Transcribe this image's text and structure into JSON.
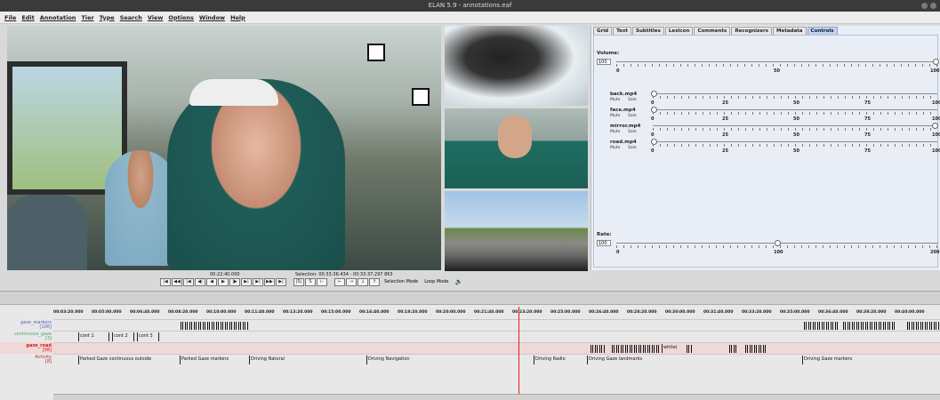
{
  "window": {
    "title": "ELAN 5.9 - annotations.eaf"
  },
  "menu": [
    "File",
    "Edit",
    "Annotation",
    "Tier",
    "Type",
    "Search",
    "View",
    "Options",
    "Window",
    "Help"
  ],
  "tabs": [
    "Grid",
    "Text",
    "Subtitles",
    "Lexicon",
    "Comments",
    "Recognizers",
    "Metadata",
    "Controls"
  ],
  "controls": {
    "volume_label": "Volume:",
    "volume_value": "100",
    "volume_ticks": [
      "0",
      "50",
      "100"
    ],
    "media": [
      {
        "name": "back.mp4",
        "mute": "Mute",
        "solo": "Solo",
        "ticks": [
          "0",
          "25",
          "50",
          "75",
          "100"
        ]
      },
      {
        "name": "face.mp4",
        "mute": "Mute",
        "solo": "Solo",
        "ticks": [
          "0",
          "25",
          "50",
          "75",
          "100"
        ]
      },
      {
        "name": "mirror.mp4",
        "mute": "Mute",
        "solo": "Solo",
        "ticks": [
          "0",
          "25",
          "50",
          "75",
          "100"
        ]
      },
      {
        "name": "road.mp4",
        "mute": "Mute",
        "solo": "Solo",
        "ticks": [
          "0",
          "25",
          "50",
          "75",
          "100"
        ]
      }
    ],
    "rate_label": "Rate:",
    "rate_value": "100",
    "rate_ticks": [
      "0",
      "100",
      "200"
    ]
  },
  "player": {
    "time": "00:22:40.000",
    "selection": "Selection: 00:33:36.434 - 00:33:37.297  863",
    "selection_mode": "Selection Mode",
    "loop_mode": "Loop Mode"
  },
  "ruler": [
    "00:03:20.000",
    "00:05:00.000",
    "00:06:40.000",
    "00:08:20.000",
    "00:10:00.000",
    "00:11:40.000",
    "00:13:20.000",
    "00:15:00.000",
    "00:16:40.000",
    "00:18:20.000",
    "00:20:00.000",
    "00:21:40.000",
    "00:23:20.000",
    "00:25:00.000",
    "00:26:40.000",
    "00:28:20.000",
    "00:30:00.000",
    "00:31:40.000",
    "00:33:20.000",
    "00:35:00.000",
    "00:36:40.000",
    "00:38:20.000",
    "00:40:00.000"
  ],
  "tiers": [
    {
      "name": "gaze_markers",
      "count": "[106]",
      "color": "#5a5fb0"
    },
    {
      "name": "continuous_gaze",
      "count": "[3]",
      "color": "#4aa86a"
    },
    {
      "name": "gaze_road",
      "count": "[98]",
      "color": "#d02020"
    },
    {
      "name": "Activity",
      "count": "[8]",
      "color": "#b03030"
    }
  ],
  "annotations": {
    "continuous": [
      "cont 1",
      "cont 2",
      "cont 3"
    ],
    "gaze_road_label": "white(",
    "activity": [
      "Parked Gaze continuous outside",
      "Parked Gaze markers",
      "Driving Natural",
      "Driving Navigation",
      "Driving Radio",
      "Driving Gaze landmarks",
      "Driving Gaze markers"
    ]
  }
}
